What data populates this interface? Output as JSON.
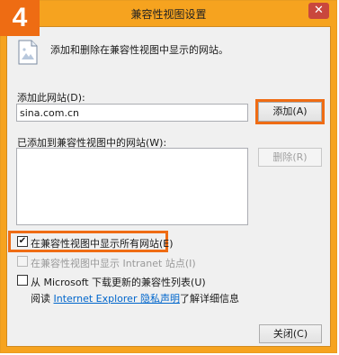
{
  "step_badge": "4",
  "window": {
    "title": "兼容性视图设置",
    "close_glyph": "✕"
  },
  "intro_text": "添加和删除在兼容性视图中显示的网站。",
  "add_site": {
    "label": "添加此网站(D):",
    "value": "sina.com.cn",
    "add_button": "添加(A)"
  },
  "added_list": {
    "label": "已添加到兼容性视图中的网站(W):",
    "remove_button": "删除(R)",
    "items": []
  },
  "options": [
    {
      "label": "在兼容性视图中显示所有网站(E)",
      "checked": true,
      "enabled": true
    },
    {
      "label": "在兼容性视图中显示 Intranet 站点(I)",
      "checked": false,
      "enabled": false
    },
    {
      "label": "从 Microsoft 下载更新的兼容性列表(U)",
      "checked": false,
      "enabled": true
    }
  ],
  "privacy": {
    "prefix": "阅读",
    "link_text": "Internet Explorer 隐私声明",
    "suffix": "了解详细信息"
  },
  "close_button": "关闭(C)",
  "colors": {
    "highlight": "#ef6c14",
    "frame": "#f6a31f",
    "link": "#0066cc"
  }
}
